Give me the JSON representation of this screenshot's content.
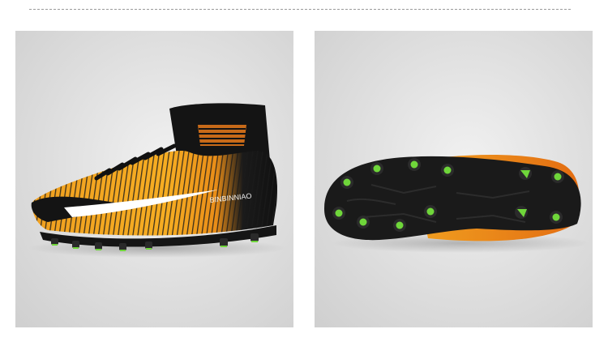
{
  "product": {
    "brand_text": "BINBINNIAO",
    "images": [
      {
        "view": "side",
        "icon": "soccer-cleat-side-icon"
      },
      {
        "view": "sole",
        "icon": "soccer-cleat-sole-icon"
      }
    ]
  },
  "colors": {
    "upper_orange": "#f3a21a",
    "upper_deep_orange": "#e36d12",
    "upper_black": "#151515",
    "stud_green": "#6fd63a",
    "background": "#dcdcdc"
  }
}
